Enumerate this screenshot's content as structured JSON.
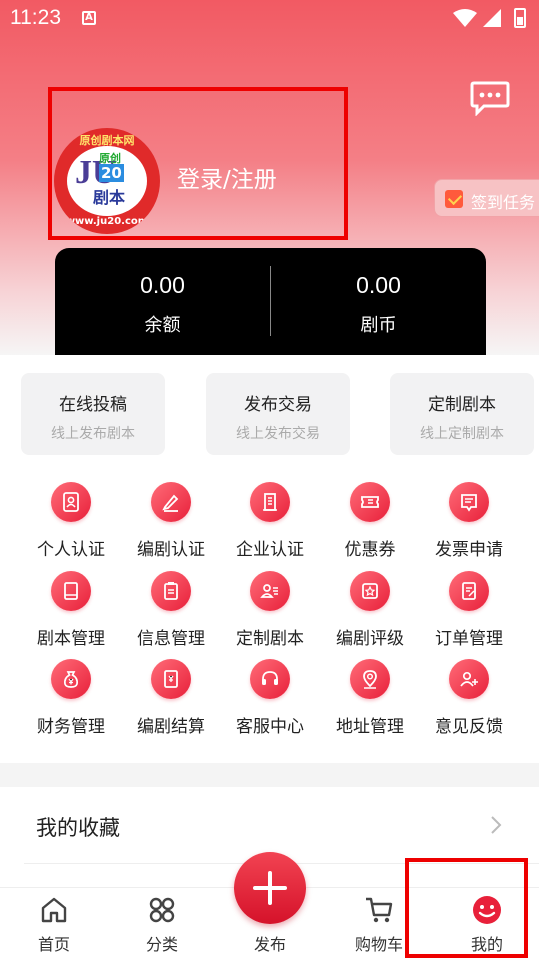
{
  "status_bar": {
    "time": "11:23",
    "notification_glyph": "A"
  },
  "header": {
    "message_icon": "chat-bubble-icon",
    "login_label": "登录/注册",
    "logo": {
      "top_text": "原创剧本网",
      "bottom_text": "www.ju20.com",
      "ju": "JU",
      "num": "20",
      "tag": "原创",
      "name": "剧本"
    },
    "checkin_label": "签到任务"
  },
  "wallet": {
    "balance_value": "0.00",
    "balance_label": "余额",
    "coin_value": "0.00",
    "coin_label": "剧币"
  },
  "quick_cards": [
    {
      "title": "在线投稿",
      "subtitle": "线上发布剧本"
    },
    {
      "title": "发布交易",
      "subtitle": "线上发布交易"
    },
    {
      "title": "定制剧本",
      "subtitle": "线上定制剧本"
    }
  ],
  "grid": [
    {
      "label": "个人认证",
      "icon": "person-card-icon"
    },
    {
      "label": "编剧认证",
      "icon": "pen-icon"
    },
    {
      "label": "企业认证",
      "icon": "building-icon"
    },
    {
      "label": "优惠券",
      "icon": "coupon-icon"
    },
    {
      "label": "发票申请",
      "icon": "invoice-icon"
    },
    {
      "label": "剧本管理",
      "icon": "book-icon"
    },
    {
      "label": "信息管理",
      "icon": "clipboard-icon"
    },
    {
      "label": "定制剧本",
      "icon": "user-list-icon"
    },
    {
      "label": "编剧评级",
      "icon": "star-badge-icon"
    },
    {
      "label": "订单管理",
      "icon": "order-icon"
    },
    {
      "label": "财务管理",
      "icon": "money-bag-icon"
    },
    {
      "label": "编剧结算",
      "icon": "ledger-icon"
    },
    {
      "label": "客服中心",
      "icon": "headset-icon"
    },
    {
      "label": "地址管理",
      "icon": "location-icon"
    },
    {
      "label": "意见反馈",
      "icon": "feedback-icon"
    }
  ],
  "favorites": {
    "title": "我的收藏"
  },
  "tabbar": [
    {
      "label": "首页",
      "icon": "home-icon"
    },
    {
      "label": "分类",
      "icon": "category-icon"
    },
    {
      "label": "发布",
      "icon": "plus-icon"
    },
    {
      "label": "购物车",
      "icon": "cart-icon"
    },
    {
      "label": "我的",
      "icon": "smile-icon"
    }
  ],
  "colors": {
    "accent": "#e8203a",
    "hero_top": "#f25a63",
    "wallet_bg": "#000000",
    "highlight_box": "#ee0000"
  }
}
